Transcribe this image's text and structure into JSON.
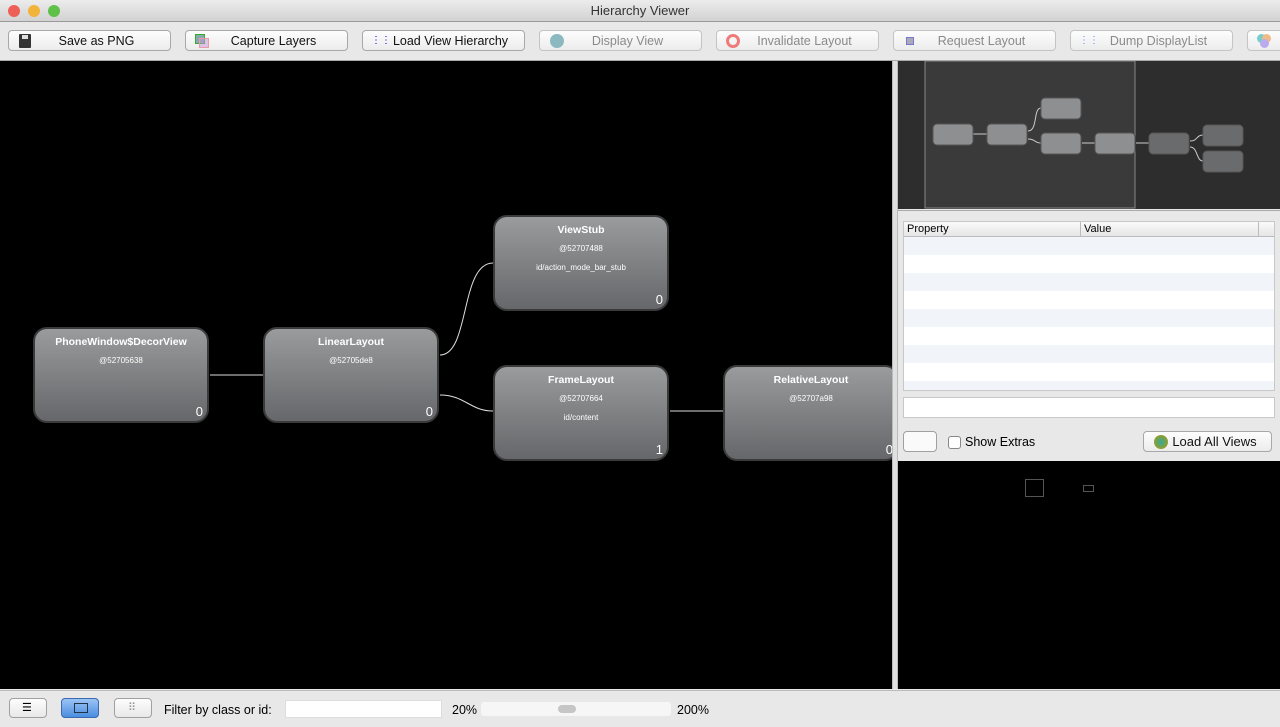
{
  "window": {
    "title": "Hierarchy Viewer"
  },
  "toolbar": {
    "buttons": [
      {
        "label": "Save as PNG",
        "icon": "floppy-icon",
        "enabled": true
      },
      {
        "label": "Capture Layers",
        "icon": "layers-icon",
        "enabled": true
      },
      {
        "label": "Load View Hierarchy",
        "icon": "hierarchy-icon",
        "enabled": true
      },
      {
        "label": "Display View",
        "icon": "globe-icon",
        "enabled": false
      },
      {
        "label": "Invalidate Layout",
        "icon": "no-entry-icon",
        "enabled": false
      },
      {
        "label": "Request Layout",
        "icon": "request-layout-icon",
        "enabled": false
      },
      {
        "label": "Dump DisplayList",
        "icon": "hierarchy-icon",
        "enabled": false
      }
    ]
  },
  "tree": {
    "nodes": [
      {
        "name": "PhoneWindow$DecorView",
        "hash": "@52705638",
        "id": "",
        "count": "0"
      },
      {
        "name": "LinearLayout",
        "hash": "@52705de8",
        "id": "",
        "count": "0"
      },
      {
        "name": "ViewStub",
        "hash": "@52707488",
        "id": "id/action_mode_bar_stub",
        "count": "0"
      },
      {
        "name": "FrameLayout",
        "hash": "@52707664",
        "id": "id/content",
        "count": "1"
      },
      {
        "name": "RelativeLayout",
        "hash": "@52707a98",
        "id": "",
        "count": "0"
      }
    ]
  },
  "properties": {
    "columns": [
      "Property",
      "Value"
    ],
    "filter_value": ""
  },
  "options": {
    "show_extras_label": "Show Extras",
    "show_extras_checked": false,
    "load_all_views_label": "Load All Views"
  },
  "bottom": {
    "filter_label": "Filter by class or id:",
    "filter_value": "",
    "zoom_min": "20%",
    "zoom_max": "200%",
    "zoom_slider_fraction": 0.45
  },
  "colors": {
    "canvas": "#000000",
    "node": "#808184"
  }
}
